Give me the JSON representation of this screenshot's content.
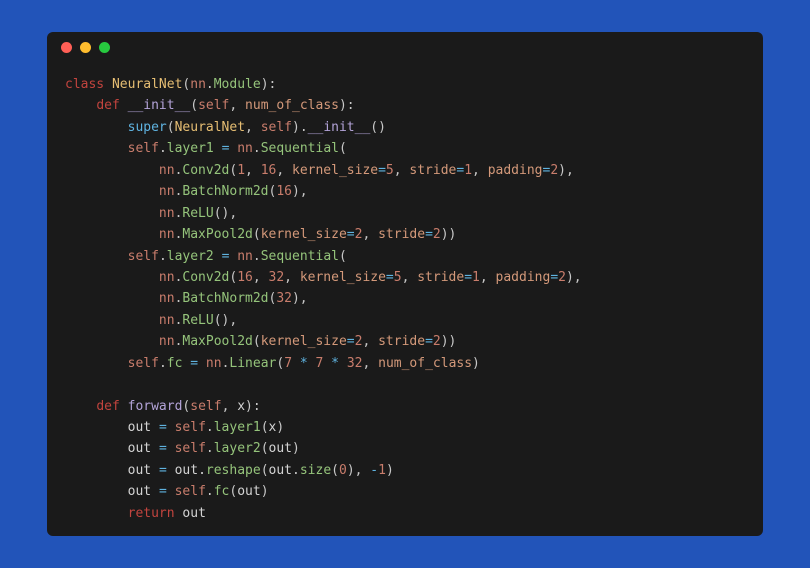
{
  "window": {
    "dots": [
      "red",
      "yellow",
      "green"
    ]
  },
  "code": {
    "lines": [
      {
        "indent": 0,
        "tokens": [
          [
            "kw",
            "class "
          ],
          [
            "cls",
            "NeuralNet"
          ],
          [
            "punct",
            "("
          ],
          [
            "self",
            "nn"
          ],
          [
            "punct",
            "."
          ],
          [
            "attr",
            "Module"
          ],
          [
            "punct",
            "):"
          ]
        ]
      },
      {
        "indent": 1,
        "tokens": [
          [
            "kw",
            "def "
          ],
          [
            "fn",
            "__init__"
          ],
          [
            "punct",
            "("
          ],
          [
            "self",
            "self"
          ],
          [
            "punct",
            ", "
          ],
          [
            "param",
            "num_of_class"
          ],
          [
            "punct",
            "):"
          ]
        ]
      },
      {
        "indent": 2,
        "tokens": [
          [
            "kw2",
            "super"
          ],
          [
            "punct",
            "("
          ],
          [
            "cls",
            "NeuralNet"
          ],
          [
            "punct",
            ", "
          ],
          [
            "self",
            "self"
          ],
          [
            "punct",
            ")."
          ],
          [
            "fn",
            "__init__"
          ],
          [
            "punct",
            "()"
          ]
        ]
      },
      {
        "indent": 2,
        "tokens": [
          [
            "self",
            "self"
          ],
          [
            "punct",
            "."
          ],
          [
            "attr",
            "layer1"
          ],
          [
            "var",
            " "
          ],
          [
            "op",
            "="
          ],
          [
            "var",
            " "
          ],
          [
            "self",
            "nn"
          ],
          [
            "punct",
            "."
          ],
          [
            "attr",
            "Sequential"
          ],
          [
            "punct",
            "("
          ]
        ]
      },
      {
        "indent": 3,
        "tokens": [
          [
            "self",
            "nn"
          ],
          [
            "punct",
            "."
          ],
          [
            "attr",
            "Conv2d"
          ],
          [
            "punct",
            "("
          ],
          [
            "num",
            "1"
          ],
          [
            "punct",
            ", "
          ],
          [
            "num",
            "16"
          ],
          [
            "punct",
            ", "
          ],
          [
            "param",
            "kernel_size"
          ],
          [
            "op",
            "="
          ],
          [
            "num",
            "5"
          ],
          [
            "punct",
            ", "
          ],
          [
            "param",
            "stride"
          ],
          [
            "op",
            "="
          ],
          [
            "num",
            "1"
          ],
          [
            "punct",
            ", "
          ],
          [
            "param",
            "padding"
          ],
          [
            "op",
            "="
          ],
          [
            "num",
            "2"
          ],
          [
            "punct",
            "),"
          ]
        ]
      },
      {
        "indent": 3,
        "tokens": [
          [
            "self",
            "nn"
          ],
          [
            "punct",
            "."
          ],
          [
            "attr",
            "BatchNorm2d"
          ],
          [
            "punct",
            "("
          ],
          [
            "num",
            "16"
          ],
          [
            "punct",
            "),"
          ]
        ]
      },
      {
        "indent": 3,
        "tokens": [
          [
            "self",
            "nn"
          ],
          [
            "punct",
            "."
          ],
          [
            "attr",
            "ReLU"
          ],
          [
            "punct",
            "(),"
          ]
        ]
      },
      {
        "indent": 3,
        "tokens": [
          [
            "self",
            "nn"
          ],
          [
            "punct",
            "."
          ],
          [
            "attr",
            "MaxPool2d"
          ],
          [
            "punct",
            "("
          ],
          [
            "param",
            "kernel_size"
          ],
          [
            "op",
            "="
          ],
          [
            "num",
            "2"
          ],
          [
            "punct",
            ", "
          ],
          [
            "param",
            "stride"
          ],
          [
            "op",
            "="
          ],
          [
            "num",
            "2"
          ],
          [
            "punct",
            "))"
          ]
        ]
      },
      {
        "indent": 2,
        "tokens": [
          [
            "self",
            "self"
          ],
          [
            "punct",
            "."
          ],
          [
            "attr",
            "layer2"
          ],
          [
            "var",
            " "
          ],
          [
            "op",
            "="
          ],
          [
            "var",
            " "
          ],
          [
            "self",
            "nn"
          ],
          [
            "punct",
            "."
          ],
          [
            "attr",
            "Sequential"
          ],
          [
            "punct",
            "("
          ]
        ]
      },
      {
        "indent": 3,
        "tokens": [
          [
            "self",
            "nn"
          ],
          [
            "punct",
            "."
          ],
          [
            "attr",
            "Conv2d"
          ],
          [
            "punct",
            "("
          ],
          [
            "num",
            "16"
          ],
          [
            "punct",
            ", "
          ],
          [
            "num",
            "32"
          ],
          [
            "punct",
            ", "
          ],
          [
            "param",
            "kernel_size"
          ],
          [
            "op",
            "="
          ],
          [
            "num",
            "5"
          ],
          [
            "punct",
            ", "
          ],
          [
            "param",
            "stride"
          ],
          [
            "op",
            "="
          ],
          [
            "num",
            "1"
          ],
          [
            "punct",
            ", "
          ],
          [
            "param",
            "padding"
          ],
          [
            "op",
            "="
          ],
          [
            "num",
            "2"
          ],
          [
            "punct",
            "),"
          ]
        ]
      },
      {
        "indent": 3,
        "tokens": [
          [
            "self",
            "nn"
          ],
          [
            "punct",
            "."
          ],
          [
            "attr",
            "BatchNorm2d"
          ],
          [
            "punct",
            "("
          ],
          [
            "num",
            "32"
          ],
          [
            "punct",
            "),"
          ]
        ]
      },
      {
        "indent": 3,
        "tokens": [
          [
            "self",
            "nn"
          ],
          [
            "punct",
            "."
          ],
          [
            "attr",
            "ReLU"
          ],
          [
            "punct",
            "(),"
          ]
        ]
      },
      {
        "indent": 3,
        "tokens": [
          [
            "self",
            "nn"
          ],
          [
            "punct",
            "."
          ],
          [
            "attr",
            "MaxPool2d"
          ],
          [
            "punct",
            "("
          ],
          [
            "param",
            "kernel_size"
          ],
          [
            "op",
            "="
          ],
          [
            "num",
            "2"
          ],
          [
            "punct",
            ", "
          ],
          [
            "param",
            "stride"
          ],
          [
            "op",
            "="
          ],
          [
            "num",
            "2"
          ],
          [
            "punct",
            "))"
          ]
        ]
      },
      {
        "indent": 2,
        "tokens": [
          [
            "self",
            "self"
          ],
          [
            "punct",
            "."
          ],
          [
            "attr",
            "fc"
          ],
          [
            "var",
            " "
          ],
          [
            "op",
            "="
          ],
          [
            "var",
            " "
          ],
          [
            "self",
            "nn"
          ],
          [
            "punct",
            "."
          ],
          [
            "attr",
            "Linear"
          ],
          [
            "punct",
            "("
          ],
          [
            "num",
            "7"
          ],
          [
            "var",
            " "
          ],
          [
            "op",
            "*"
          ],
          [
            "var",
            " "
          ],
          [
            "num",
            "7"
          ],
          [
            "var",
            " "
          ],
          [
            "op",
            "*"
          ],
          [
            "var",
            " "
          ],
          [
            "num",
            "32"
          ],
          [
            "punct",
            ", "
          ],
          [
            "param",
            "num_of_class"
          ],
          [
            "punct",
            ")"
          ]
        ]
      },
      {
        "indent": 0,
        "tokens": []
      },
      {
        "indent": 1,
        "tokens": [
          [
            "kw",
            "def "
          ],
          [
            "fn",
            "forward"
          ],
          [
            "punct",
            "("
          ],
          [
            "self",
            "self"
          ],
          [
            "punct",
            ", "
          ],
          [
            "var",
            "x"
          ],
          [
            "punct",
            "):"
          ]
        ]
      },
      {
        "indent": 2,
        "tokens": [
          [
            "var",
            "out "
          ],
          [
            "op",
            "="
          ],
          [
            "var",
            " "
          ],
          [
            "self",
            "self"
          ],
          [
            "punct",
            "."
          ],
          [
            "attr",
            "layer1"
          ],
          [
            "punct",
            "("
          ],
          [
            "var",
            "x"
          ],
          [
            "punct",
            ")"
          ]
        ]
      },
      {
        "indent": 2,
        "tokens": [
          [
            "var",
            "out "
          ],
          [
            "op",
            "="
          ],
          [
            "var",
            " "
          ],
          [
            "self",
            "self"
          ],
          [
            "punct",
            "."
          ],
          [
            "attr",
            "layer2"
          ],
          [
            "punct",
            "("
          ],
          [
            "var",
            "out"
          ],
          [
            "punct",
            ")"
          ]
        ]
      },
      {
        "indent": 2,
        "tokens": [
          [
            "var",
            "out "
          ],
          [
            "op",
            "="
          ],
          [
            "var",
            " out."
          ],
          [
            "attr",
            "reshape"
          ],
          [
            "punct",
            "("
          ],
          [
            "var",
            "out"
          ],
          [
            "punct",
            "."
          ],
          [
            "attr",
            "size"
          ],
          [
            "punct",
            "("
          ],
          [
            "num",
            "0"
          ],
          [
            "punct",
            "), "
          ],
          [
            "op",
            "-"
          ],
          [
            "num",
            "1"
          ],
          [
            "punct",
            ")"
          ]
        ]
      },
      {
        "indent": 2,
        "tokens": [
          [
            "var",
            "out "
          ],
          [
            "op",
            "="
          ],
          [
            "var",
            " "
          ],
          [
            "self",
            "self"
          ],
          [
            "punct",
            "."
          ],
          [
            "attr",
            "fc"
          ],
          [
            "punct",
            "("
          ],
          [
            "var",
            "out"
          ],
          [
            "punct",
            ")"
          ]
        ]
      },
      {
        "indent": 2,
        "tokens": [
          [
            "kw",
            "return"
          ],
          [
            "var",
            " out"
          ]
        ]
      }
    ]
  }
}
